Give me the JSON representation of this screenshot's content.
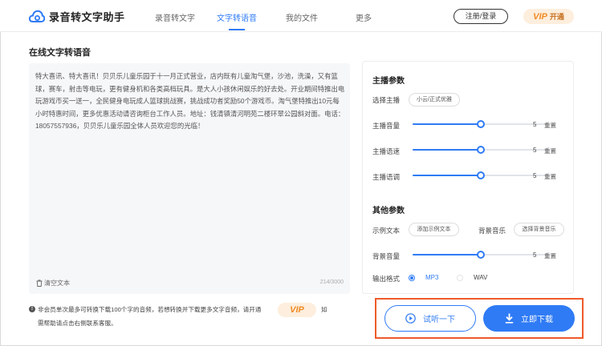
{
  "header": {
    "app_name": "录音转文字助手",
    "nav": [
      "录音转文字",
      "文字转语音",
      "我的文件",
      "更多"
    ],
    "active_nav": 1,
    "login_label": "注册/登录",
    "vip_logo": "VIP",
    "vip_label": "开通"
  },
  "page_title": "在线文字转语音",
  "editor": {
    "text": "特大喜讯、特大喜讯！贝贝乐儿童乐园于十一月正式营业，店内既有儿童淘气堡，沙池，洗澡，又有篮球，赛车，射击等电玩，更有健身机和各类高档玩具。是大人小孩休闲娱乐的好去处。开业期间特推出电玩游戏币买一送一，全民健身电玩成人篮球挑战赛，挑战成功者奖励50个游戏币。淘气堡特推出10元每小时特惠时间，更多优惠活动请咨询柜台工作人员。地址：钱清镇清河明苑二楼环翠公园斜对面。电话：18057557936，贝贝乐儿童乐园全体人员欢迎您的光临！",
    "clear_label": "清空文本",
    "char_count": "214/3000"
  },
  "settings": {
    "broadcast_title": "主播参数",
    "anchor_label": "选择主播",
    "anchor_value": "小云/正式优雅",
    "volume_label": "主播音量",
    "volume_value": "5",
    "speed_label": "主播语速",
    "speed_value": "5",
    "pitch_label": "主播语调",
    "pitch_value": "5",
    "reset_label": "重置",
    "other_title": "其他参数",
    "sample_label": "示例文本",
    "sample_button": "添加示例文本",
    "bgm_label": "背景音乐",
    "bgm_button": "选择背景音乐",
    "bgm_volume_label": "背景音量",
    "bgm_volume_value": "5",
    "format_label": "输出格式",
    "format_options": [
      "MP3",
      "WAV"
    ],
    "format_selected": "MP3",
    "slider_level": 0.5
  },
  "notice": {
    "line1": "非会员单次最多可转换下载100个字的音频，若想转换并下载更多文字音频，请开通",
    "vip": "VIP",
    "tail": "如",
    "line2": "需帮助请点击右侧联系客服。"
  },
  "actions": {
    "listen_label": "试听一下",
    "download_label": "立即下载"
  },
  "colors": {
    "accent": "#2f7bf5",
    "vip_orange": "#f08a24",
    "highlight_border": "#ef5a2a"
  }
}
